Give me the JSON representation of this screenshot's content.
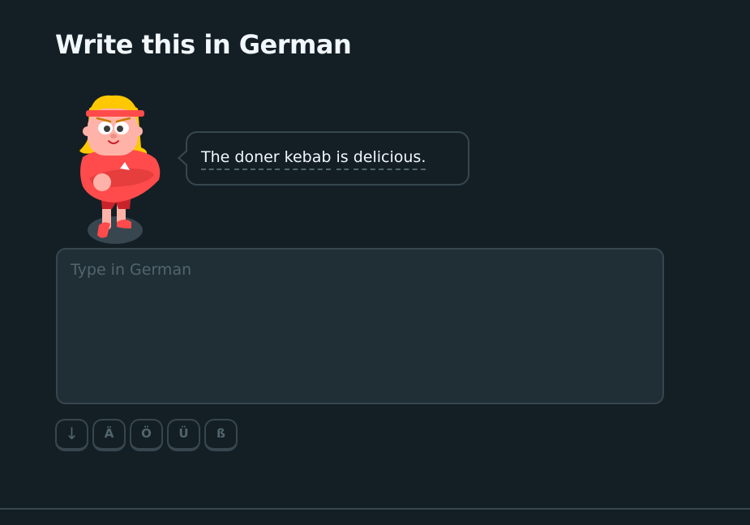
{
  "header": {
    "title": "Write this in German"
  },
  "prompt": {
    "character": "duo-character-lily",
    "words": [
      "The",
      "doner",
      "kebab",
      "is",
      "delicious."
    ]
  },
  "answer": {
    "placeholder": "Type in German",
    "value": ""
  },
  "keyboard": {
    "toggle_icon": "down-arrow-icon",
    "toggle_glyph": "↓",
    "keys": [
      "Ä",
      "Ö",
      "Ü",
      "ß"
    ]
  },
  "colors": {
    "background": "#141f25",
    "panel": "#202f36",
    "border": "#37464f",
    "muted": "#52656d",
    "text": "#f1f7fb",
    "character_shirt": "#ff4b4b",
    "character_hair": "#ffc800"
  }
}
